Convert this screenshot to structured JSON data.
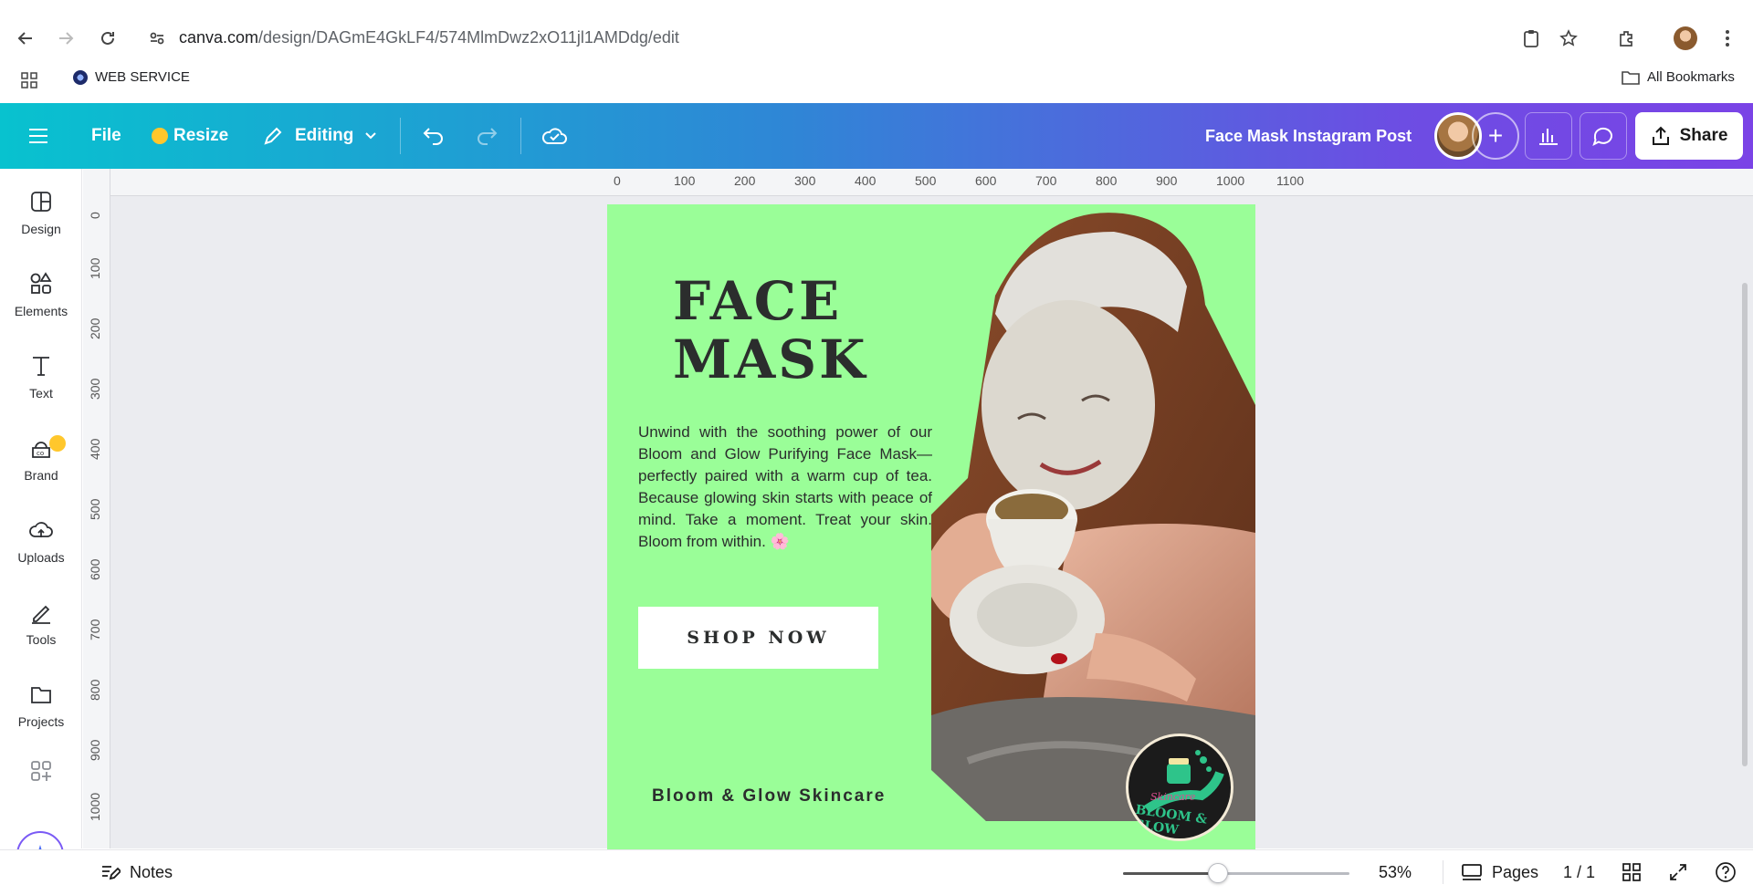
{
  "browser": {
    "url_host": "canva.com",
    "url_path": "/design/DAGmE4GkLF4/574MlmDwz2xO11jl1AMDdg/edit",
    "bookmark": "WEB SERVICE",
    "all_bookmarks": "All Bookmarks"
  },
  "topbar": {
    "file": "File",
    "resize": "Resize",
    "editing": "Editing",
    "title": "Face Mask Instagram Post",
    "share": "Share"
  },
  "sidebar": {
    "items": [
      {
        "label": "Design",
        "icon": "design-icon"
      },
      {
        "label": "Elements",
        "icon": "elements-icon"
      },
      {
        "label": "Text",
        "icon": "text-icon"
      },
      {
        "label": "Brand",
        "icon": "brand-icon"
      },
      {
        "label": "Uploads",
        "icon": "uploads-icon"
      },
      {
        "label": "Tools",
        "icon": "tools-icon"
      },
      {
        "label": "Projects",
        "icon": "projects-icon"
      }
    ]
  },
  "rulers": {
    "top": [
      "0",
      "100",
      "200",
      "300",
      "400",
      "500",
      "600",
      "700",
      "800",
      "900",
      "1000",
      "1100"
    ],
    "left": [
      "0",
      "100",
      "200",
      "300",
      "400",
      "500",
      "600",
      "700",
      "800",
      "900",
      "1000"
    ]
  },
  "design": {
    "headline_1": "FACE",
    "headline_2": "MASK",
    "body": "Unwind with the soothing power of our Bloom and Glow Purifying  Face Mask—perfectly paired with a warm cup of tea. Because glowing skin starts with peace of mind. Take a moment. Treat your skin. Bloom from within. 🌸",
    "cta": "SHOP NOW",
    "brand": "Bloom & Glow Skincare",
    "logo_script": "Skincare",
    "logo_name": "BLOOM & GLOW",
    "background": "#9afe98"
  },
  "bottombar": {
    "notes": "Notes",
    "zoom": "53%",
    "zoom_fraction": 0.42,
    "pages": "Pages",
    "page_count": "1 / 1"
  },
  "colors": {
    "accent_start": "#08c2cf",
    "accent_end": "#7a43e6",
    "design_bg": "#9afe98"
  }
}
